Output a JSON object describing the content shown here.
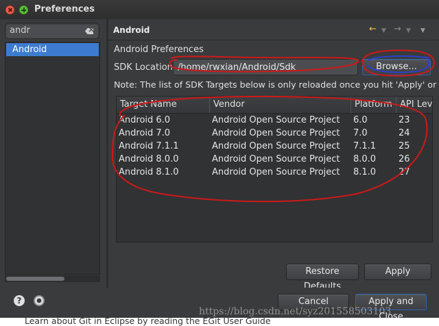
{
  "window": {
    "title": "Preferences"
  },
  "sidebar": {
    "filter_value": "andr",
    "items": [
      {
        "label": "Android",
        "selected": true
      }
    ]
  },
  "header": {
    "title": "Android",
    "nav": {
      "back_icon": "←",
      "forward_icon": "→"
    }
  },
  "main": {
    "pref_title": "Android Preferences",
    "sdk_label": "SDK Location:",
    "sdk_value": "/home/rwxian/Android/Sdk",
    "browse_label": "Browse...",
    "note": "Note: The list of SDK Targets below is only reloaded once you hit 'Apply' or 'OK'.",
    "table": {
      "columns": [
        "Target Name",
        "Vendor",
        "Platform",
        "API Level"
      ],
      "rows": [
        [
          "Android 6.0",
          "Android Open Source Project",
          "6.0",
          "23"
        ],
        [
          "Android 7.0",
          "Android Open Source Project",
          "7.0",
          "24"
        ],
        [
          "Android 7.1.1",
          "Android Open Source Project",
          "7.1.1",
          "25"
        ],
        [
          "Android 8.0.0",
          "Android Open Source Project",
          "8.0.0",
          "26"
        ],
        [
          "Android 8.1.0",
          "Android Open Source Project",
          "8.1.0",
          "27"
        ]
      ]
    },
    "restore_defaults_label": "Restore Defaults",
    "apply_label": "Apply"
  },
  "footer": {
    "help_icon": "?",
    "cancel_label": "Cancel",
    "apply_close_label": "Apply and Close"
  },
  "underlay_text": "Learn about Git in Eclipse by reading the EGit User Guide",
  "watermark": "https://blog.csdn.net/syz201558503103",
  "colors": {
    "selection": "#3d7bd0",
    "annotation": "#d01818",
    "annotation_blue": "#2a40d8"
  }
}
